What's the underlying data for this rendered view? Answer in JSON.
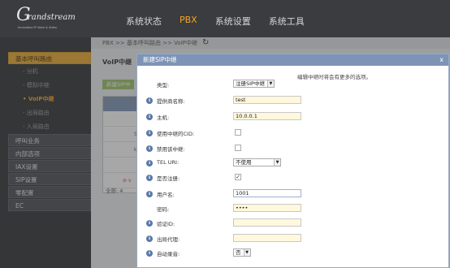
{
  "brand": {
    "logo_glyph": "G",
    "logo_word": "randstream",
    "tagline": "Innovative IP Voice & Video"
  },
  "nav": [
    {
      "label": "系统状态",
      "active": false
    },
    {
      "label": "PBX",
      "active": true
    },
    {
      "label": "系统设置",
      "active": false
    },
    {
      "label": "系统工具",
      "active": false
    }
  ],
  "sidebar": {
    "open_group": "基本呼叫路由",
    "sub_items": [
      {
        "label": "分机",
        "active": false
      },
      {
        "label": "模拟中继",
        "active": false
      },
      {
        "label": "VoIP中继",
        "active": true
      },
      {
        "label": "出局路由",
        "active": false
      },
      {
        "label": "入局路由",
        "active": false
      }
    ],
    "groups": [
      "呼叫业务",
      "内部选项",
      "IAX设置",
      "SIP设置",
      "零配置",
      "EC"
    ]
  },
  "main": {
    "breadcrumb": "PBX >> 基本呼叫路由 >> VoIP中继",
    "title": "VoIP中继",
    "new_button": "新建SIP中",
    "cells": [
      "S",
      "kingl",
      "v"
    ],
    "total": "全部: 4"
  },
  "modal": {
    "title": "新建SIP中继",
    "close": "x",
    "hint": "编辑中继时将会有更多的选项。",
    "fields": {
      "type_label": "类型:",
      "type_value": "注册SIP中继",
      "provider_label": "提供商名称:",
      "provider_value": "test",
      "host_label": "主机:",
      "host_value": "10.0.0.1",
      "use_cid_label": "使用中继的CID:",
      "use_cid_checked": false,
      "disable_label": "禁用该中继:",
      "disable_checked": false,
      "teluri_label": "TEL URI:",
      "teluri_value": "不使用",
      "register_label": "是否注册:",
      "register_checked": true,
      "username_label": "用户名:",
      "username_value": "1001",
      "password_label": "密码:",
      "password_value": "••••",
      "authid_label": "验证ID:",
      "authid_value": "",
      "proxy_label": "出局代理:",
      "proxy_value": "",
      "autorecord_label": "自动录音:",
      "autorecord_value": "否"
    }
  },
  "colors": {
    "accent": "#f5a623",
    "modal_header": "#7e94b6",
    "info_icon": "#5a78a8"
  }
}
